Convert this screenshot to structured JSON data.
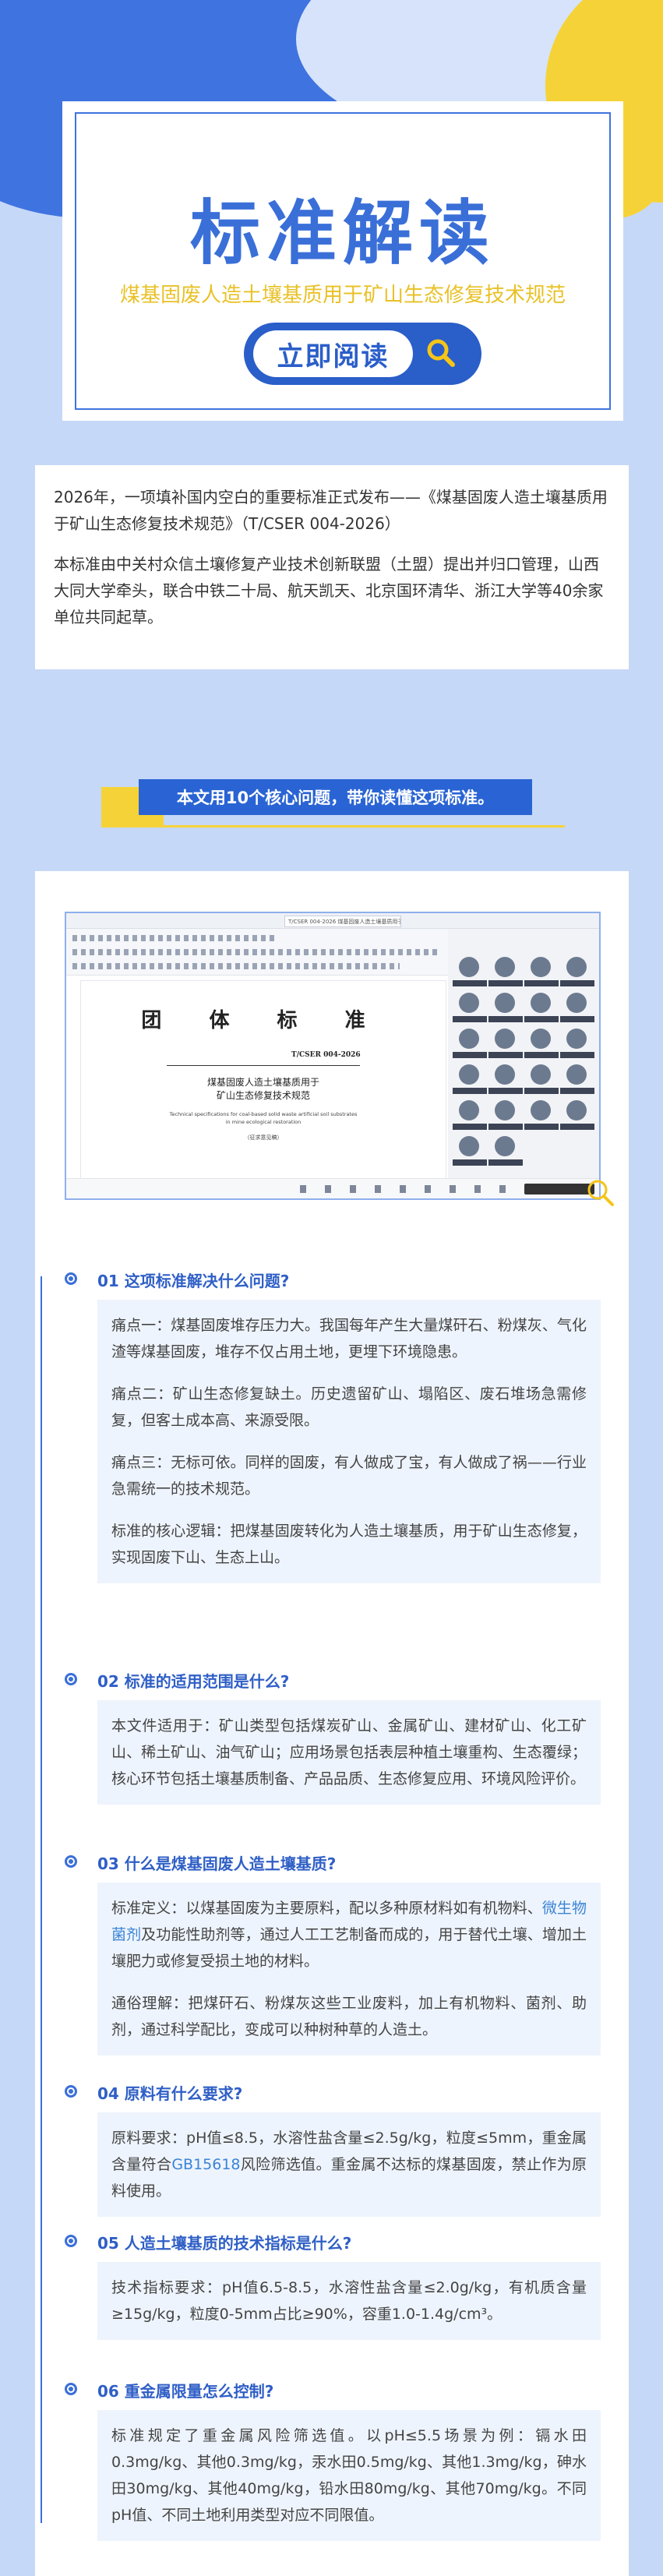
{
  "hero": {
    "title": "标准解读",
    "subtitle": "煤基固废人造土壤基质用于矿山生态修复技术规范",
    "read_button": "立即阅读"
  },
  "intro": {
    "p1": "2026年，一项填补国内空白的重要标准正式发布——《煤基固废人造土壤基质用于矿山生态修复技术规范》（T/CSER 004-2026）",
    "p2": "本标准由中关村众信土壤修复产业技术创新联盟（土盟）提出并归口管理，山西大同大学牵头，联合中铁二十局、航天凯天、北京国环清华、浙江大学等40余家单位共同起草。"
  },
  "banner": "本文用10个核心问题，带你读懂这项标准。",
  "screenshot": {
    "doc_title": "团 体 标 准",
    "doc_code": "T/CSER 004-2026",
    "doc_name_1": "煤基固废人造土壤基质用于",
    "doc_name_2": "矿山生态修复技术规范",
    "doc_en_1": "Technical specifications for coal-based solid waste artificial soil substrates",
    "doc_en_2": "in mine ecological restoration",
    "doc_draft": "（征求意见稿）",
    "tab_label": "T/CSER 004-2026 煤基固废人造土壤基质用于矿山生态修复技术规范"
  },
  "qa": [
    {
      "title": "01 这项标准解决什么问题?",
      "paragraphs": [
        "痛点一：煤基固废堆存压力大。我国每年产生大量煤矸石、粉煤灰、气化渣等煤基固废，堆存不仅占用土地，更埋下环境隐患。",
        "痛点二：矿山生态修复缺土。历史遗留矿山、塌陷区、废石堆场急需修复，但客土成本高、来源受限。",
        "痛点三：无标可依。同样的固废，有人做成了宝，有人做成了祸——行业急需统一的技术规范。",
        "标准的核心逻辑：把煤基固废转化为人造土壤基质，用于矿山生态修复，实现固废下山、生态上山。"
      ]
    },
    {
      "title": "02 标准的适用范围是什么?",
      "paragraphs": [
        "本文件适用于：矿山类型包括煤炭矿山、金属矿山、建材矿山、化工矿山、稀土矿山、油气矿山；应用场景包括表层种植土壤重构、生态覆绿；核心环节包括土壤基质制备、产品品质、生态修复应用、环境风险评价。"
      ]
    },
    {
      "title": "03 什么是煤基固废人造土壤基质?",
      "p1_before": "标准定义：以煤基固废为主要原料，配以多种原材料如有机物料、",
      "p1_link": "微生物菌剂",
      "p1_after": "及功能性助剂等，通过人工工艺制备而成的，用于替代土壤、增加土壤肥力或修复受损土地的材料。",
      "p2": "通俗理解：把煤矸石、粉煤灰这些工业废料，加上有机物料、菌剂、助剂，通过科学配比，变成可以种树种草的人造土。"
    },
    {
      "title": "04 原料有什么要求?",
      "p1_before": "原料要求：pH值≤8.5，水溶性盐含量≤2.5g/kg，粒度≤5mm，重金属含量符合",
      "p1_link": "GB15618",
      "p1_after": "风险筛选值。重金属不达标的煤基固废，禁止作为原料使用。"
    },
    {
      "title": "05 人造土壤基质的技术指标是什么?",
      "paragraphs": [
        "技术指标要求：pH值6.5-8.5，水溶性盐含量≤2.0g/kg，有机质含量≥15g/kg，粒度0-5mm占比≥90%，容重1.0-1.4g/cm³。"
      ]
    },
    {
      "title": "06 重金属限量怎么控制?",
      "paragraphs": [
        "标准规定了重金属风险筛选值。以pH≤5.5场景为例：镉水田0.3mg/kg、其他0.3mg/kg，汞水田0.5mg/kg、其他1.3mg/kg，砷水田30mg/kg、其他40mg/kg，铅水田80mg/kg、其他70mg/kg。不同pH值、不同土地利用类型对应不同限值。"
      ]
    }
  ],
  "colors": {
    "page_bg": "#c6d8f7",
    "accent_blue": "#3a6fd8",
    "accent_yellow": "#f5d338",
    "link": "#3a84d6"
  }
}
